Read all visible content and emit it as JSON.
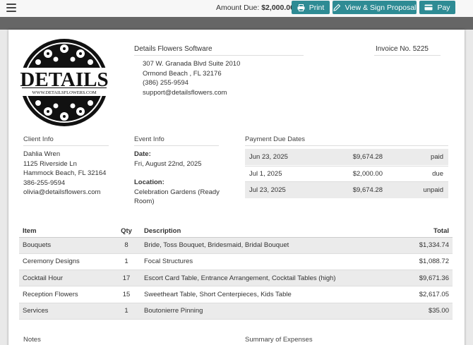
{
  "topbar": {
    "amount_label": "Amount Due:",
    "amount_value": "$2,000.00",
    "print_label": "Print",
    "view_sign_label": "View & Sign Proposal",
    "pay_label": "Pay",
    "accent_color": "#2e8b94"
  },
  "logo": {
    "wordmark": "DETAILS",
    "url_text": "WWW.DETAILSFLOWERS.COM"
  },
  "company": {
    "name": "Details Flowers Software",
    "invoice_label": "Invoice No. 5225",
    "address_lines": [
      "307 W. Granada Blvd Suite 2010",
      "Ormond Beach , FL 32176",
      "(386) 255-9594",
      "support@detailsflowers.com"
    ]
  },
  "client": {
    "heading": "Client Info",
    "lines": [
      "Dahlia Wren",
      "1125 Riverside Ln",
      "Hammock Beach, FL 32164",
      "386-255-9594",
      "olivia@detailsflowers.com"
    ]
  },
  "event": {
    "heading": "Event Info",
    "date_label": "Date:",
    "date_value": "Fri, August 22nd, 2025",
    "location_label": "Location:",
    "location_value": "Celebration Gardens (Ready Room)"
  },
  "payments": {
    "heading": "Payment Due Dates",
    "rows": [
      {
        "date": "Jun 23, 2025",
        "amount": "$9,674.28",
        "status": "paid"
      },
      {
        "date": "Jul 1, 2025",
        "amount": "$2,000.00",
        "status": "due"
      },
      {
        "date": "Jul 23, 2025",
        "amount": "$9,674.28",
        "status": "unpaid"
      }
    ]
  },
  "items": {
    "headers": {
      "item": "Item",
      "qty": "Qty",
      "description": "Description",
      "total": "Total"
    },
    "rows": [
      {
        "item": "Bouquets",
        "qty": "8",
        "description": "Bride, Toss Bouquet, Bridesmaid, Bridal Bouquet",
        "total": "$1,334.74"
      },
      {
        "item": "Ceremony Designs",
        "qty": "1",
        "description": "Focal Structures",
        "total": "$1,088.72"
      },
      {
        "item": "Cocktail Hour",
        "qty": "17",
        "description": "Escort Card Table, Entrance Arrangement, Cocktail Tables (high)",
        "total": "$9,671.36"
      },
      {
        "item": "Reception Flowers",
        "qty": "15",
        "description": "Sweetheart Table, Short Centerpieces, Kids Table",
        "total": "$2,617.05"
      },
      {
        "item": "Services",
        "qty": "1",
        "description": "Boutonierre Pinning",
        "total": "$35.00"
      }
    ]
  },
  "notes": {
    "heading": "Notes"
  },
  "summary": {
    "heading": "Summary of Expenses"
  }
}
